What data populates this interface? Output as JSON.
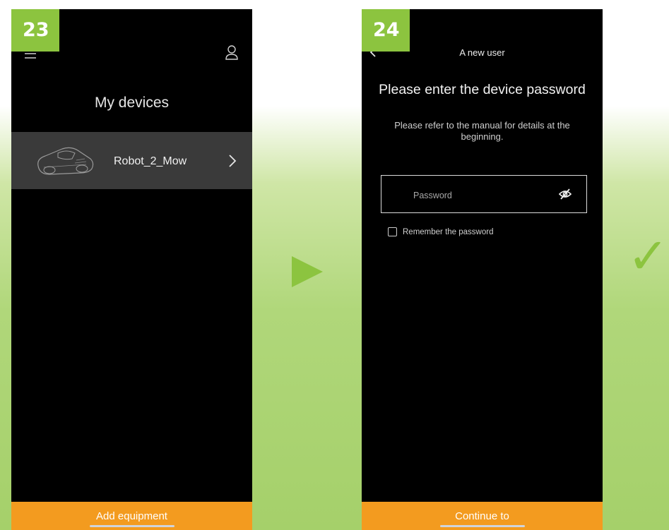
{
  "steps": {
    "left": "23",
    "right": "24"
  },
  "screen1": {
    "title": "My devices",
    "devices": [
      {
        "name": "Robot_2_Mow"
      }
    ],
    "bottom_button": "Add equipment",
    "icons": {
      "menu": "hamburger-icon",
      "account": "user-icon",
      "device": "mower-icon",
      "open": "chevron-right-icon"
    }
  },
  "screen2": {
    "nav_title": "A new user",
    "heading": "Please enter the device password",
    "subtext": "Please refer to the manual for details at the beginning.",
    "password_placeholder": "Password",
    "remember_label": "Remember the password",
    "bottom_button": "Continue to",
    "icons": {
      "back": "chevron-left-icon",
      "visibility": "eye-slash-icon"
    }
  },
  "decor": {
    "arrow": "play-arrow-icon",
    "done": "check-mark-icon",
    "check_glyph": "✓"
  },
  "colors": {
    "accent_green": "#8cc43f",
    "button_orange": "#f39b1f",
    "device_row": "#3a3a3a",
    "screen_bg": "#000000"
  }
}
